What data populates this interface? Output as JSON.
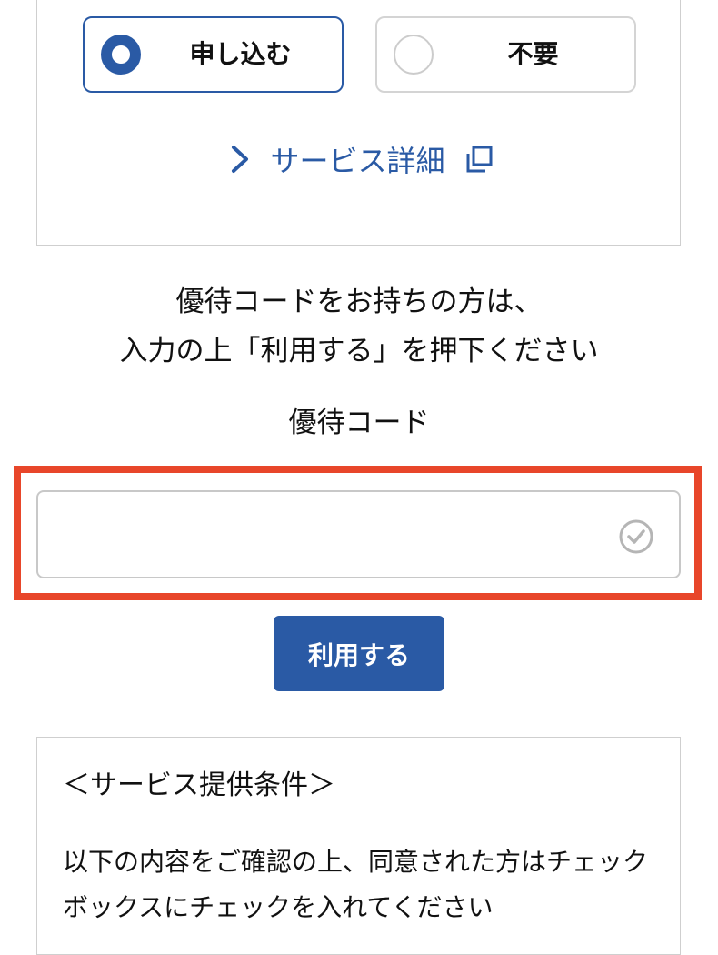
{
  "option_section": {
    "apply_label": "申し込む",
    "decline_label": "不要",
    "selected": "apply",
    "service_link_label": "サービス詳細"
  },
  "promo": {
    "instruction_line1": "優待コードをお持ちの方は、",
    "instruction_line2": "入力の上「利用する」を押下ください",
    "field_title": "優待コード",
    "input_value": "",
    "input_placeholder": "",
    "button_label": "利用する"
  },
  "terms": {
    "title": "＜サービス提供条件＞",
    "body": "以下の内容をご確認の上、同意された方はチェックボックスにチェックを入れてください"
  },
  "colors": {
    "accent": "#2a5aa5",
    "highlight": "#e8462a",
    "border": "#cfcfcf"
  },
  "icons": {
    "link_chevron": "chevron-right-icon",
    "external": "external-link-icon",
    "input_status": "check-circle-icon"
  }
}
